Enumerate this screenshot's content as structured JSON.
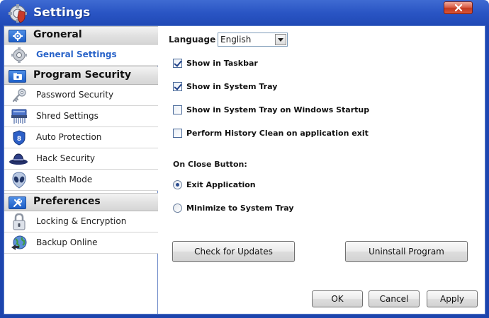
{
  "window": {
    "title": "Settings",
    "close_label": "×"
  },
  "sidebar": {
    "sections": [
      {
        "label": "Groneral",
        "icon": "gear-icon",
        "items": [
          {
            "label": "General Settings",
            "icon": "gear-icon",
            "active": true
          }
        ]
      },
      {
        "label": "Program Security",
        "icon": "folder-lock-icon",
        "items": [
          {
            "label": "Password Security",
            "icon": "key-icon"
          },
          {
            "label": "Shred Settings",
            "icon": "shredder-icon"
          },
          {
            "label": "Auto Protection",
            "icon": "shield-icon"
          },
          {
            "label": "Hack Security",
            "icon": "hacker-hat-icon"
          },
          {
            "label": "Stealth Mode",
            "icon": "alien-icon"
          }
        ]
      },
      {
        "label": "Preferences",
        "icon": "tools-icon",
        "items": [
          {
            "label": "Locking & Encryption",
            "icon": "padlock-icon"
          },
          {
            "label": "Backup Online",
            "icon": "globe-backup-icon"
          }
        ]
      }
    ]
  },
  "general": {
    "language_label": "Language",
    "language_value": "English",
    "checkboxes": [
      {
        "label": "Show in Taskbar",
        "checked": true
      },
      {
        "label": "Show in System Tray",
        "checked": true
      },
      {
        "label": "Show in System Tray on Windows Startup",
        "checked": false
      },
      {
        "label": "Perform History Clean on application exit",
        "checked": false
      }
    ],
    "close_heading": "On Close Button:",
    "radios": [
      {
        "label": "Exit Application",
        "checked": true
      },
      {
        "label": "Minimize to System Tray",
        "checked": false
      }
    ],
    "check_updates_label": "Check for Updates",
    "uninstall_label": "Uninstall Program"
  },
  "footer": {
    "ok_label": "OK",
    "cancel_label": "Cancel",
    "apply_label": "Apply"
  },
  "colors": {
    "titlebar": "#2a55c4",
    "active_item": "#2a64c9",
    "close_button": "#c2391f"
  }
}
